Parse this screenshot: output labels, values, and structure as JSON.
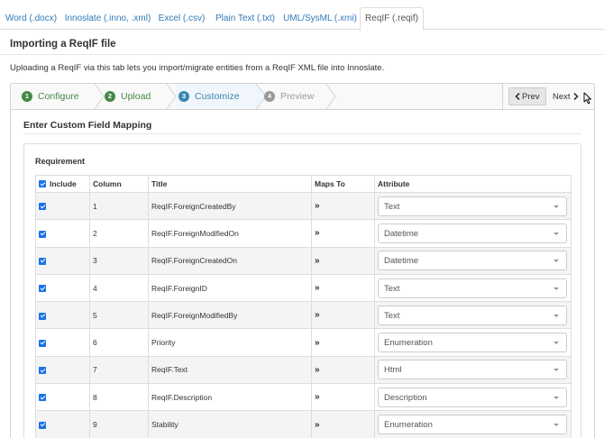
{
  "tabs": [
    {
      "label": "Word (.docx)",
      "active": false
    },
    {
      "label": "Innoslate (.inno, .xml)",
      "active": false
    },
    {
      "label": "Excel (.csv)",
      "active": false
    },
    {
      "label": "Plain Text (.txt)",
      "active": false
    },
    {
      "label": "UML/SysML (.xmi)",
      "active": false
    },
    {
      "label": "ReqIF (.reqif)",
      "active": true
    }
  ],
  "page": {
    "title": "Importing a ReqIF file",
    "description": "Uploading a ReqIF via this tab lets you import/migrate entities from a ReqIF XML file into Innoslate."
  },
  "wizard": {
    "steps": [
      {
        "number": "1",
        "label": "Configure",
        "state": "complete"
      },
      {
        "number": "2",
        "label": "Upload",
        "state": "complete"
      },
      {
        "number": "3",
        "label": "Customize",
        "state": "current"
      },
      {
        "number": "4",
        "label": "Preview",
        "state": "pending"
      }
    ],
    "prev_label": "Prev",
    "next_label": "Next"
  },
  "mapping": {
    "title": "Enter Custom Field Mapping",
    "entity_class": "Requirement",
    "headers": {
      "include": "Include",
      "column": "Column",
      "title": "Title",
      "maps_to": "Maps To",
      "attribute": "Attribute"
    },
    "rows": [
      {
        "included": true,
        "column": "1",
        "title": "ReqIF.ForeignCreatedBy",
        "maps": "»",
        "attribute": "Text"
      },
      {
        "included": true,
        "column": "2",
        "title": "ReqIF.ForeignModifiedOn",
        "maps": "»",
        "attribute": "Datetime"
      },
      {
        "included": true,
        "column": "3",
        "title": "ReqIF.ForeignCreatedOn",
        "maps": "»",
        "attribute": "Datetime"
      },
      {
        "included": true,
        "column": "4",
        "title": "ReqIF.ForeignID",
        "maps": "»",
        "attribute": "Text"
      },
      {
        "included": true,
        "column": "5",
        "title": "ReqIF.ForeignModifiedBy",
        "maps": "»",
        "attribute": "Text"
      },
      {
        "included": true,
        "column": "6",
        "title": "Priority",
        "maps": "»",
        "attribute": "Enumeration"
      },
      {
        "included": true,
        "column": "7",
        "title": "ReqIF.Text",
        "maps": "»",
        "attribute": "Html"
      },
      {
        "included": true,
        "column": "8",
        "title": "ReqIF.Description",
        "maps": "»",
        "attribute": "Description"
      },
      {
        "included": true,
        "column": "9",
        "title": "Stability",
        "maps": "»",
        "attribute": "Enumeration"
      }
    ]
  },
  "colors": {
    "link": "#337ab7",
    "step_complete": "#468847",
    "step_current": "#3a87ad",
    "step_pending": "#999999",
    "checkbox": "#1a73e8"
  },
  "icons": {
    "prev": "chevron-left-icon",
    "next": "chevron-right-icon",
    "cursor": "mouse-pointer-icon",
    "select": "caret-down-icon"
  }
}
